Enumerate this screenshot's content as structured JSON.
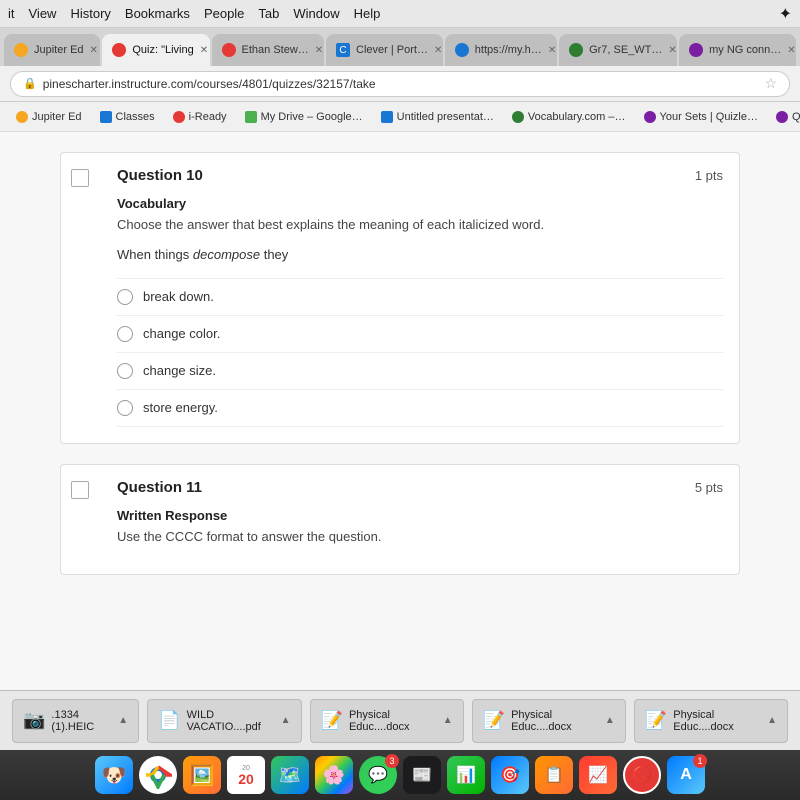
{
  "menubar": {
    "items": [
      "it",
      "View",
      "History",
      "Bookmarks",
      "People",
      "Tab",
      "Window",
      "Help"
    ],
    "bluetooth": "✦"
  },
  "tabs": [
    {
      "id": "tab1",
      "label": "Jupiter Ed",
      "favicon_type": "orange",
      "active": false
    },
    {
      "id": "tab2",
      "label": "Quiz: \"Living",
      "favicon_type": "red",
      "active": true
    },
    {
      "id": "tab3",
      "label": "Ethan Stew…",
      "favicon_type": "red",
      "active": false
    },
    {
      "id": "tab4",
      "label": "C Clever | Port…",
      "favicon_type": "blue",
      "active": false
    },
    {
      "id": "tab5",
      "label": "https://my.h…",
      "favicon_type": "blue-round",
      "active": false
    },
    {
      "id": "tab6",
      "label": "Gr7, SE_WT…",
      "favicon_type": "green",
      "active": false
    },
    {
      "id": "tab7",
      "label": "my NG conn…",
      "favicon_type": "purple",
      "active": false
    }
  ],
  "address": {
    "url": "pinescharter.instructure.com/courses/4801/quizzes/32157/take",
    "lock_icon": "🔒"
  },
  "bookmarks": [
    {
      "label": "Jupiter Ed",
      "icon_color": "#f5a623"
    },
    {
      "label": "Classes",
      "icon_color": "#1976d2"
    },
    {
      "label": "i-Ready",
      "icon_color": "#e53935"
    },
    {
      "label": "My Drive – Google…",
      "icon_color": "#4caf50"
    },
    {
      "label": "Untitled presentat…",
      "icon_color": "#1976d2"
    },
    {
      "label": "Vocabulary.com –…",
      "icon_color": "#2e7d32"
    },
    {
      "label": "Your Sets | Quizle…",
      "icon_color": "#7b1fa2"
    },
    {
      "label": "Quizlet Live",
      "icon_color": "#7b1fa2"
    }
  ],
  "questions": [
    {
      "id": "q10",
      "number": "Question 10",
      "points": "1 pts",
      "type": "Vocabulary",
      "instruction": "Choose the answer that best explains the meaning of each italicized word.",
      "question_text": "When things decompose they",
      "options": [
        {
          "id": "a",
          "text": "break down."
        },
        {
          "id": "b",
          "text": "change color."
        },
        {
          "id": "c",
          "text": "change size."
        },
        {
          "id": "d",
          "text": "store energy."
        }
      ]
    },
    {
      "id": "q11",
      "number": "Question 11",
      "points": "5 pts",
      "type": "Written Response",
      "instruction": "Use the CCCC format to answer the question.",
      "question_text": "",
      "options": []
    }
  ],
  "downloads": [
    {
      "name": ".1334 (1).HEIC",
      "type": "HEIC"
    },
    {
      "name": "WILD VACATIO....pdf",
      "type": "PDF"
    },
    {
      "name": "Physical Educ....docx",
      "type": "DOCX"
    },
    {
      "name": "Physical Educ....docx",
      "type": "DOCX"
    },
    {
      "name": "Physical Educ....docx",
      "type": "DOCX"
    }
  ],
  "dock_items": [
    {
      "label": "finder",
      "emoji": "😀",
      "color": "#007aff"
    },
    {
      "label": "chrome",
      "emoji": "🌐",
      "color": "#ffffff"
    },
    {
      "label": "photos",
      "emoji": "🖼️",
      "color": "#ff9500"
    },
    {
      "label": "calendar",
      "emoji": "📅",
      "color": "#ffffff"
    },
    {
      "label": "maps",
      "emoji": "🗺️",
      "color": "#34c759"
    },
    {
      "label": "photo-library",
      "emoji": "📷",
      "color": "#ff6b35"
    },
    {
      "label": "messages",
      "emoji": "💬",
      "color": "#34c759"
    },
    {
      "label": "news",
      "emoji": "📰",
      "color": "#ff3b30"
    },
    {
      "label": "numbers",
      "emoji": "📊",
      "color": "#34c759"
    },
    {
      "label": "keynote",
      "emoji": "🎯",
      "color": "#007aff"
    },
    {
      "label": "slides",
      "emoji": "📋",
      "color": "#ff9500"
    },
    {
      "label": "bars",
      "emoji": "📈",
      "color": "#ff3b30"
    },
    {
      "label": "no-entry",
      "emoji": "🚫",
      "color": "#ff3b30"
    },
    {
      "label": "appstore",
      "emoji": "🅐",
      "color": "#007aff"
    }
  ]
}
